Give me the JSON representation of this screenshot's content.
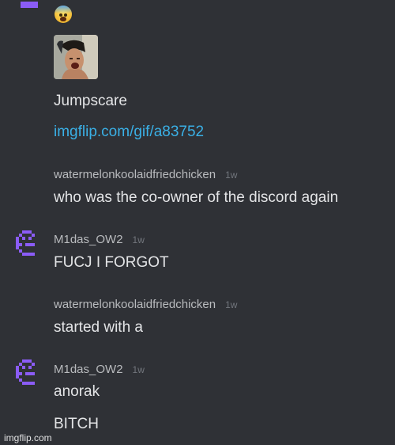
{
  "messages": {
    "top": {
      "emoji": "fearful-face-emoji",
      "embed_title": "Jumpscare",
      "link": "imgflip.com/gif/a83752"
    },
    "m1": {
      "user": "watermelonkoolaidfriedchicken",
      "time": "1w",
      "text": "who was the co-owner of the discord again"
    },
    "m2": {
      "user": "M1das_OW2",
      "time": "1w",
      "text": "FUCJ I FORGOT"
    },
    "m3": {
      "user": "watermelonkoolaidfriedchicken",
      "time": "1w",
      "text": "started with a"
    },
    "m4": {
      "user": "M1das_OW2",
      "time": "1w",
      "text": "anorak",
      "text2": "BITCH"
    }
  },
  "colors": {
    "background": "#2f3136",
    "avatar_purple": "#8b5cf6",
    "link": "#3ab0e6",
    "username": "#b9bbbe",
    "timestamp": "#72767d"
  },
  "watermark": "imgflip.com"
}
